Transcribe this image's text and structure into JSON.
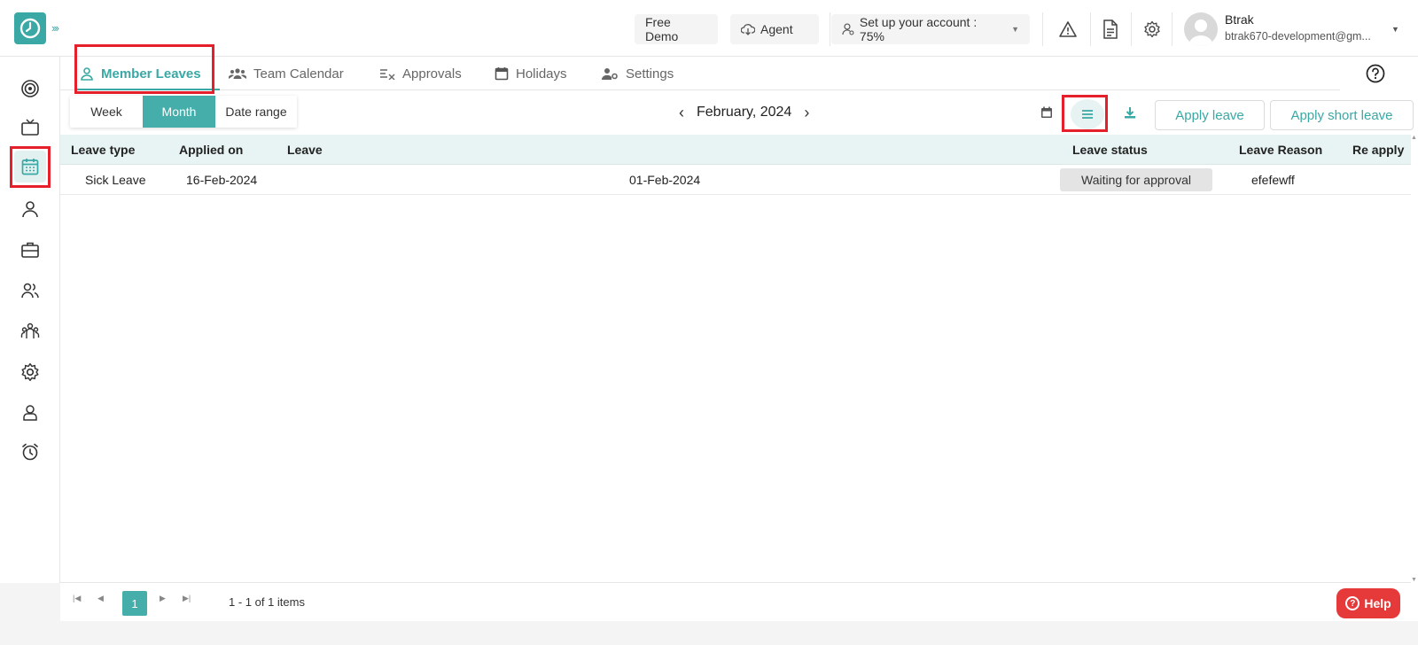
{
  "header": {
    "free_demo": "Free Demo",
    "agent": "Agent",
    "setup": "Set up your account : 75%",
    "user_name": "Btrak",
    "user_email": "btrak670-development@gm..."
  },
  "tabs": [
    {
      "label": "Member Leaves"
    },
    {
      "label": "Team Calendar"
    },
    {
      "label": "Approvals"
    },
    {
      "label": "Holidays"
    },
    {
      "label": "Settings"
    }
  ],
  "toolbar": {
    "views": [
      "Week",
      "Month",
      "Date range"
    ],
    "active_view": "Month",
    "period": "February, 2024",
    "apply_leave": "Apply leave",
    "apply_short_leave": "Apply short leave"
  },
  "table": {
    "columns": [
      "Leave type",
      "Applied on",
      "Leave",
      "Leave status",
      "Leave Reason",
      "Re apply"
    ],
    "rows": [
      {
        "leave_type": "Sick Leave",
        "applied_on": "16-Feb-2024",
        "leave": "01-Feb-2024",
        "status": "Waiting for approval",
        "reason": "efefewff",
        "reapply": ""
      }
    ]
  },
  "pager": {
    "current_page": "1",
    "info": "1 - 1 of 1 items"
  },
  "help_label": "Help",
  "colors": {
    "accent": "#3aa8a4",
    "highlight": "#e5202b",
    "help": "#e63a3a"
  }
}
